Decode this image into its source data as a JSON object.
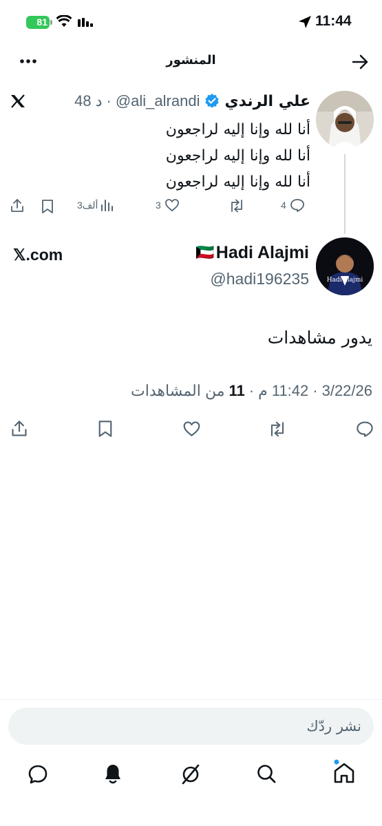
{
  "status_bar": {
    "time": "11:44",
    "battery": "81"
  },
  "header": {
    "title": "المنشور"
  },
  "quoted_post": {
    "name": "علي الرندي",
    "handle": "@ali_alrandi",
    "separator": "·",
    "age": "48 د",
    "lines": [
      "أنا لله وإنا إليه لراجعون",
      "أنا لله وإنا إليه لراجعون",
      "أنا لله وإنا إليه لراجعون"
    ],
    "replies": "4",
    "likes": "3",
    "views": "3ألف"
  },
  "main_post": {
    "flag": "🇰🇼",
    "name": "Hadi Alajmi",
    "handle": "@hadi196235",
    "source": "𝕏.com",
    "avatar_caption": "Hadi alajmi",
    "text": "يدور مشاهدات",
    "date": "3/22/26",
    "time": "11:42 م",
    "dot": "·",
    "views_count": "11",
    "views_label": "من المشاهدات"
  },
  "reply": {
    "placeholder": "نشر ردّك"
  },
  "icons": [
    "signal-icon",
    "wifi-icon",
    "battery-icon",
    "location-arrow-icon",
    "more-icon",
    "back-arrow-icon",
    "verified-badge-icon",
    "x-logo-icon",
    "reply-icon",
    "repost-icon",
    "like-icon",
    "views-icon",
    "bookmark-icon",
    "share-icon",
    "home-icon",
    "search-icon",
    "grok-icon",
    "notifications-icon",
    "messages-icon"
  ],
  "colors": {
    "verified": "#1d9bf0",
    "battery": "#34c759",
    "secondary_text": "#536471",
    "home_dot": "#1d9bf0"
  }
}
